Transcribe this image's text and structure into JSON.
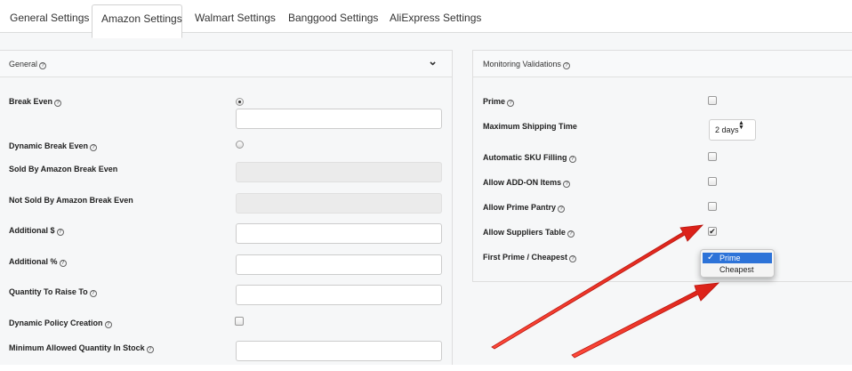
{
  "tabs": [
    {
      "label": "General Settings"
    },
    {
      "label": "Amazon Settings"
    },
    {
      "label": "Walmart Settings"
    },
    {
      "label": "Banggood Settings"
    },
    {
      "label": "AliExpress Settings"
    }
  ],
  "general": {
    "title": "General",
    "fields": {
      "break_even": "Break Even",
      "dynamic_break_even": "Dynamic Break Even",
      "sold_by_amazon": "Sold By Amazon Break Even",
      "not_sold_by_amazon": "Not Sold By Amazon Break Even",
      "additional_dollar": "Additional $",
      "additional_percent": "Additional %",
      "quantity_to_raise": "Quantity To Raise To",
      "dynamic_policy": "Dynamic Policy Creation",
      "min_quantity": "Minimum Allowed Quantity In Stock"
    }
  },
  "monitoring": {
    "title": "Monitoring Validations",
    "fields": {
      "prime": "Prime",
      "max_shipping": "Maximum Shipping Time",
      "auto_sku": "Automatic SKU Filling",
      "addon": "Allow ADD-ON Items",
      "pantry": "Allow Prime Pantry",
      "suppliers": "Allow Suppliers Table",
      "first_prime": "First Prime / Cheapest"
    },
    "shipping_value": "2 days",
    "dropdown_options": [
      "Prime",
      "Cheapest"
    ]
  },
  "icons": {
    "help": "?",
    "chevron": "⌄",
    "check": "✔",
    "menu_check": "✓",
    "select_arrows": "▲▼"
  },
  "colors": {
    "arrow": "#e8322a",
    "selected_option": "#2d73d8"
  }
}
